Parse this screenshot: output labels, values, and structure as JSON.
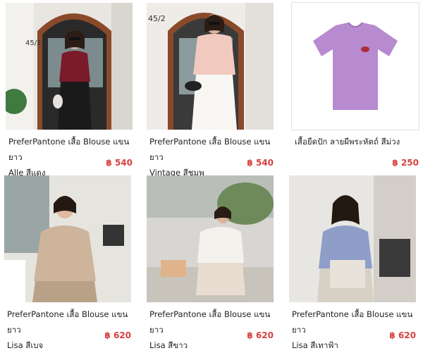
{
  "products": [
    {
      "title_line1": "PreferPantone เสื้อ Blouse แขนยาว",
      "title_line2": "Alle สีแดง",
      "price": "฿ 540",
      "photo": "woman-maroon-blouse-storefront"
    },
    {
      "title_line1": "PreferPantone เสื้อ Blouse แขนยาว",
      "title_line2": "Vintage สีชมพู",
      "price": "฿ 540",
      "photo": "woman-pink-blouse-storefront"
    },
    {
      "title_line1": "เสื้อยืดปัก ลายผีพระหัตถ์ สีม่วง",
      "title_line2": "",
      "price": "฿ 250",
      "photo": "purple-tshirt-embroidered"
    },
    {
      "title_line1": "PreferPantone เสื้อ Blouse แขนยาว",
      "title_line2": "Lisa สีเบจ",
      "price": "฿ 620",
      "photo": "woman-beige-satin-blouse"
    },
    {
      "title_line1": "PreferPantone เสื้อ Blouse แขนยาว",
      "title_line2": "Lisa สีขาว",
      "price": "฿ 620",
      "photo": "woman-white-blouse-street"
    },
    {
      "title_line1": "PreferPantone เสื้อ Blouse แขนยาว",
      "title_line2": "Lisa สีเทาฟ้า",
      "price": "฿ 620",
      "photo": "woman-bluegray-satin-blouse"
    }
  ],
  "storefront_sign_1": "45/2",
  "storefront_sign_2": "45/2",
  "colors": {
    "price": "#d64040",
    "title": "#222222"
  }
}
